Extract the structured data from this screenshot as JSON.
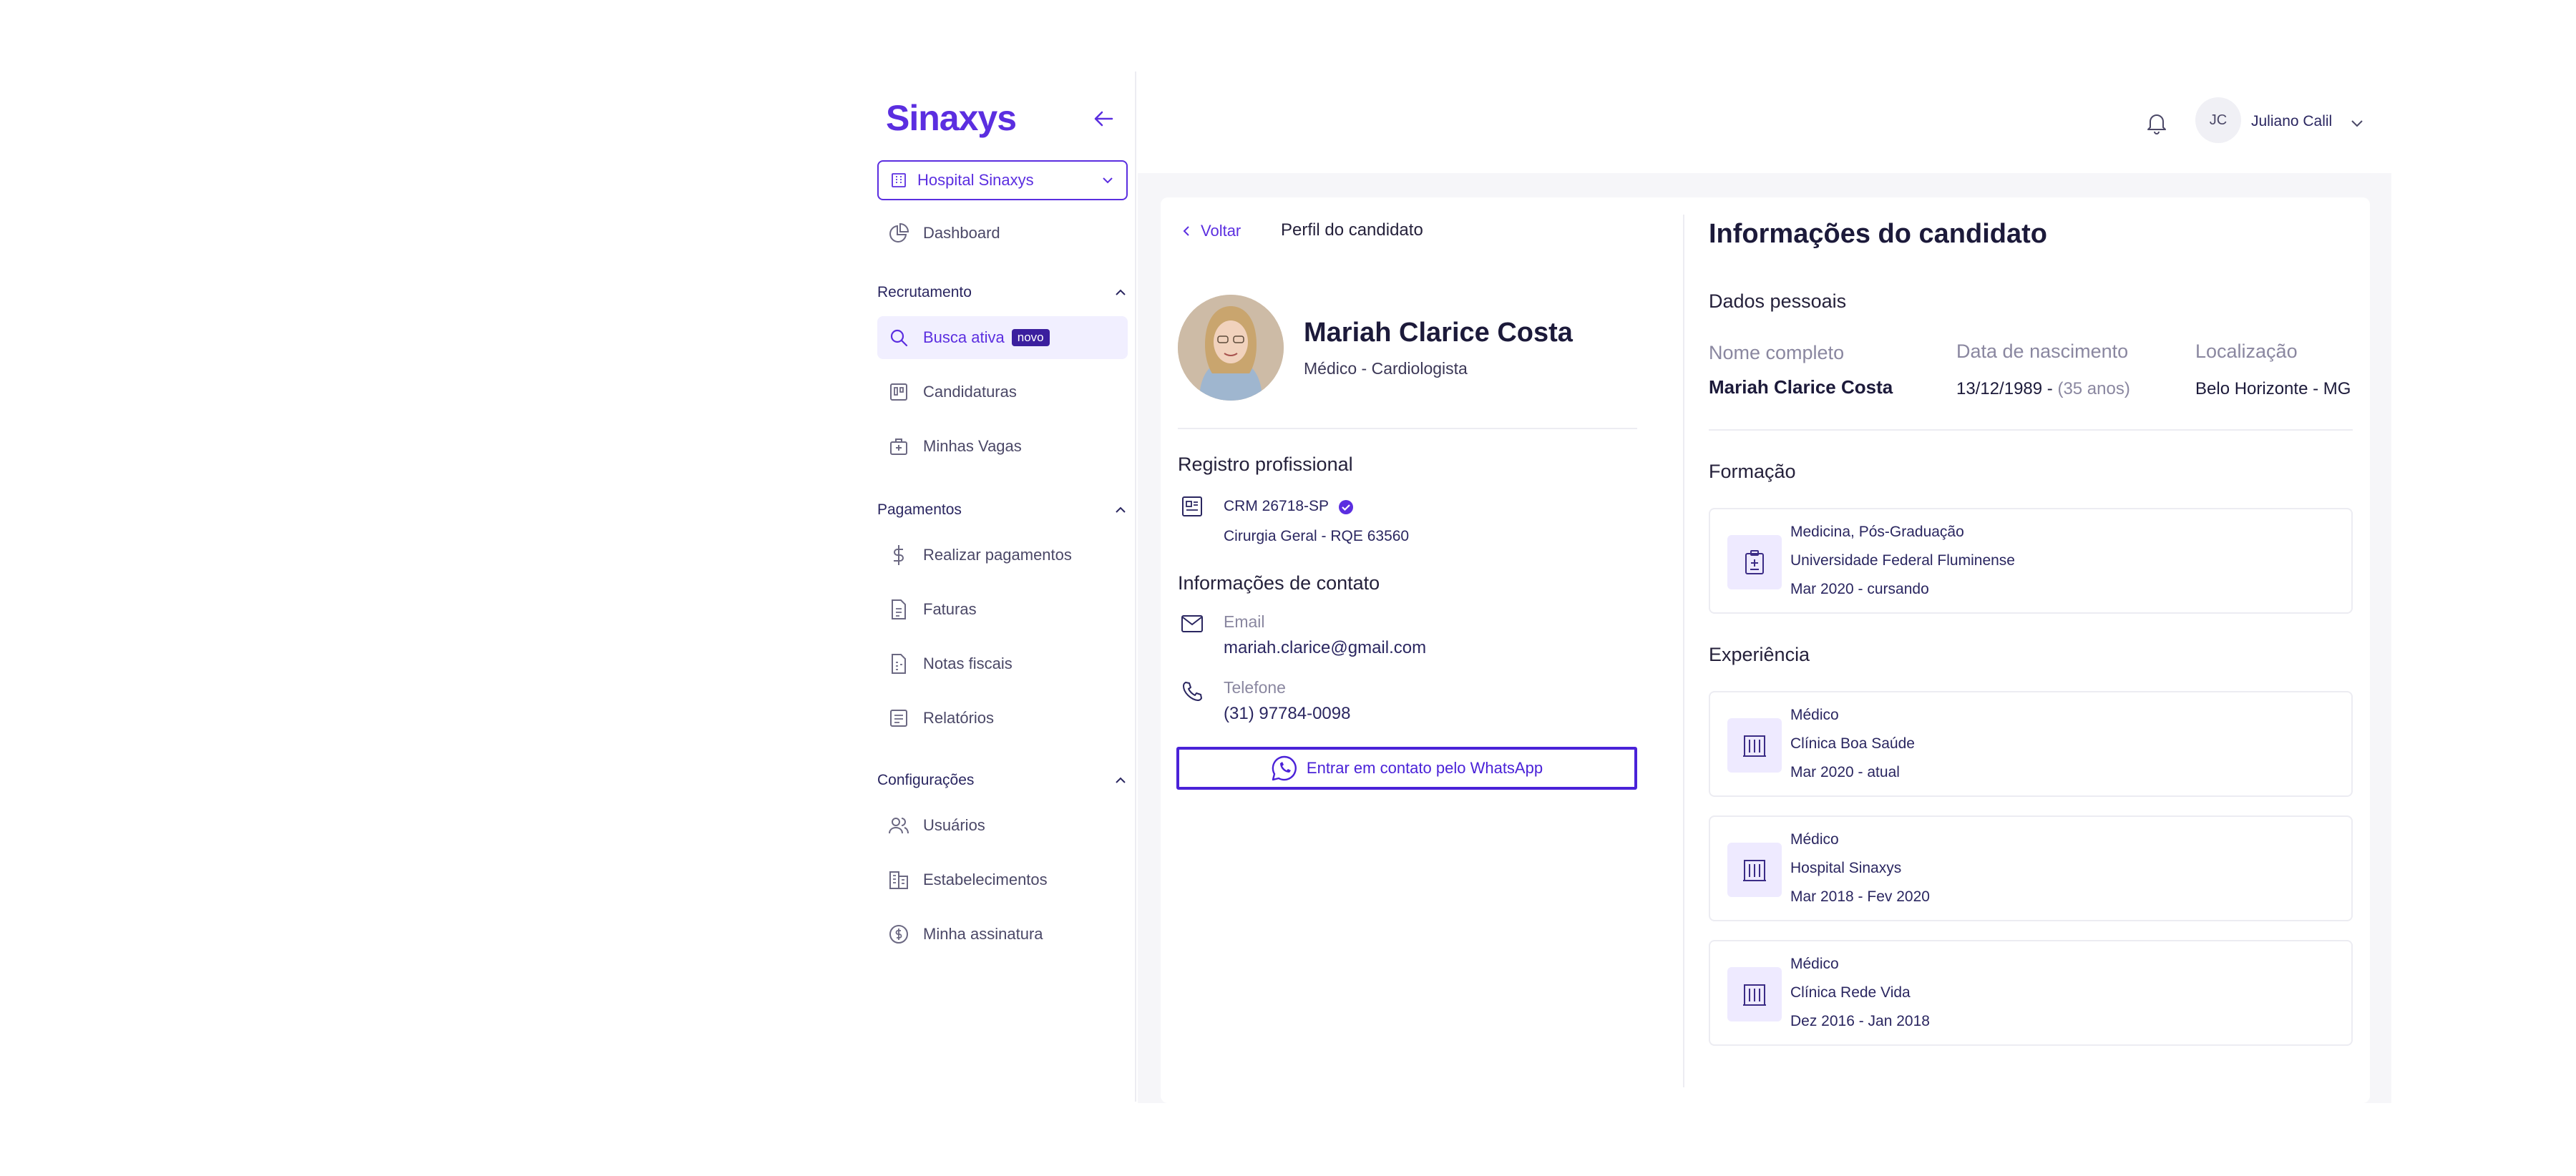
{
  "sidebar": {
    "logo": "Sinaxys",
    "hospital": "Hospital Sinaxys",
    "dashboard": "Dashboard",
    "sections": {
      "recrutamento": "Recrutamento",
      "pagamentos": "Pagamentos",
      "configuracoes": "Configurações"
    },
    "items": {
      "busca_ativa": "Busca ativa",
      "busca_badge": "novo",
      "candidaturas": "Candidaturas",
      "minhas_vagas": "Minhas Vagas",
      "realizar_pagamentos": "Realizar pagamentos",
      "faturas": "Faturas",
      "notas_fiscais": "Notas fiscais",
      "relatorios": "Relatórios",
      "usuarios": "Usuários",
      "estabelecimentos": "Estabelecimentos",
      "minha_assinatura": "Minha assinatura"
    }
  },
  "header": {
    "user_initials": "JC",
    "user_name": "Juliano Calil"
  },
  "profile": {
    "back": "Voltar",
    "title": "Perfil do candidato",
    "name": "Mariah Clarice Costa",
    "role": "Médico - Cardiologista",
    "registro_title": "Registro profissional",
    "crm": "CRM 26718-SP",
    "especialidade": "Cirurgia Geral - RQE 63560",
    "contato_title": "Informações de contato",
    "email_label": "Email",
    "email": "mariah.clarice@gmail.com",
    "telefone_label": "Telefone",
    "telefone": "(31) 97784-0098",
    "whatsapp_button": "Entrar em contato pelo WhatsApp"
  },
  "info": {
    "title": "Informações do candidato",
    "dados_pessoais": "Dados pessoais",
    "nome_label": "Nome completo",
    "nome": "Mariah Clarice Costa",
    "nascimento_label": "Data de nascimento",
    "nascimento": "13/12/1989 -",
    "idade": "(35 anos)",
    "localizacao_label": "Localização",
    "localizacao": "Belo Horizonte - MG",
    "formacao_title": "Formação",
    "formacao": {
      "curso": "Medicina, Pós-Graduação",
      "instituicao": "Universidade Federal Fluminense",
      "periodo": "Mar 2020 - cursando"
    },
    "experiencia_title": "Experiência",
    "experiencias": [
      {
        "cargo": "Médico",
        "local": "Clínica Boa Saúde",
        "periodo": "Mar 2020 - atual"
      },
      {
        "cargo": "Médico",
        "local": "Hospital Sinaxys",
        "periodo": "Mar 2018 - Fev 2020"
      },
      {
        "cargo": "Médico",
        "local": "Clínica Rede Vida",
        "periodo": "Dez 2016 - Jan 2018"
      }
    ]
  }
}
